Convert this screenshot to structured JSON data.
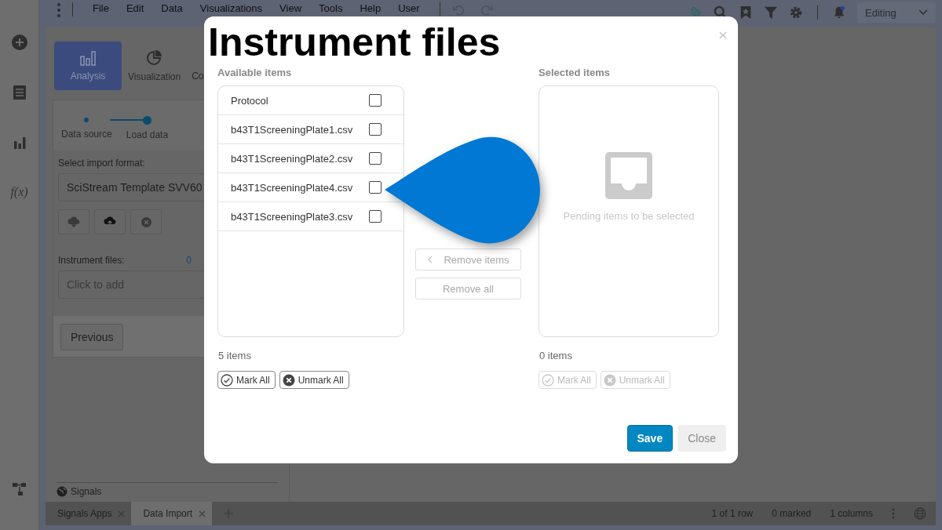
{
  "rail": {
    "function_label": "f(x)"
  },
  "menubar": {
    "menus": [
      "File",
      "Edit",
      "Data",
      "Visualizations",
      "View",
      "Tools",
      "Help",
      "User"
    ],
    "mode": "Editing"
  },
  "panel": {
    "tabs": [
      {
        "label": "Analysis",
        "selected": true
      },
      {
        "label": "Visualization",
        "selected": false
      },
      {
        "label": "Co",
        "selected": false
      }
    ],
    "steps": [
      {
        "label": "Data source",
        "selected": false
      },
      {
        "label": "Load data",
        "selected": true
      }
    ],
    "format_label": "Select import format:",
    "format_value": "SciStream Template SVV60",
    "files_label": "Instrument files:",
    "files_count": "0",
    "files_placeholder": "Click to add",
    "previous": "Previous",
    "signals": "Signals"
  },
  "doc_tabs": [
    {
      "label": "Signals Apps",
      "selected": false
    },
    {
      "label": "Data Import",
      "selected": true
    }
  ],
  "status": [
    "1 of 1 row",
    "0 marked",
    "1 columns"
  ],
  "dialog": {
    "title": "Instrument files",
    "available": {
      "heading": "Available items",
      "items": [
        {
          "label": "Protocol",
          "checked": false
        },
        {
          "label": "b43T1ScreeningPlate1.csv",
          "checked": false
        },
        {
          "label": "b43T1ScreeningPlate2.csv",
          "checked": false
        },
        {
          "label": "b43T1ScreeningPlate4.csv",
          "checked": false
        },
        {
          "label": "b43T1ScreeningPlate3.csv",
          "checked": false
        }
      ],
      "count": "5 items",
      "mark_all": "Mark All",
      "unmark_all": "Unmark All",
      "disabled": false
    },
    "selected": {
      "heading": "Selected items",
      "empty": "Pending items to be selected",
      "count": "0 items",
      "mark_all": "Mark All",
      "unmark_all": "Unmark All",
      "disabled": true
    },
    "remove_items": "Remove items",
    "remove_all": "Remove all",
    "save": "Save",
    "close": "Close"
  }
}
